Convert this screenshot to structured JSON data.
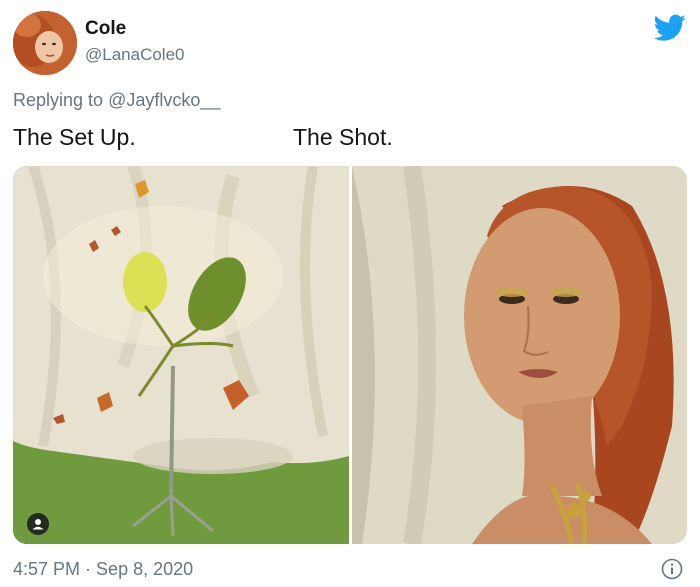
{
  "tweet": {
    "display_name": "Cole",
    "handle": "@LanaCole0",
    "replying_prefix": "Replying to ",
    "replying_to": "@Jayflvcko__",
    "text_left": "The Set Up.",
    "text_right": "The Shot.",
    "time": "4:57 PM",
    "separator": " · ",
    "date": "Sep 8, 2020"
  },
  "icons": {
    "brand": "twitter-bird-icon",
    "photo_tag": "person-icon",
    "info": "info-icon"
  },
  "colors": {
    "twitter_blue": "#1da1f2",
    "secondary_text": "#657786",
    "primary_text": "#14171a"
  }
}
